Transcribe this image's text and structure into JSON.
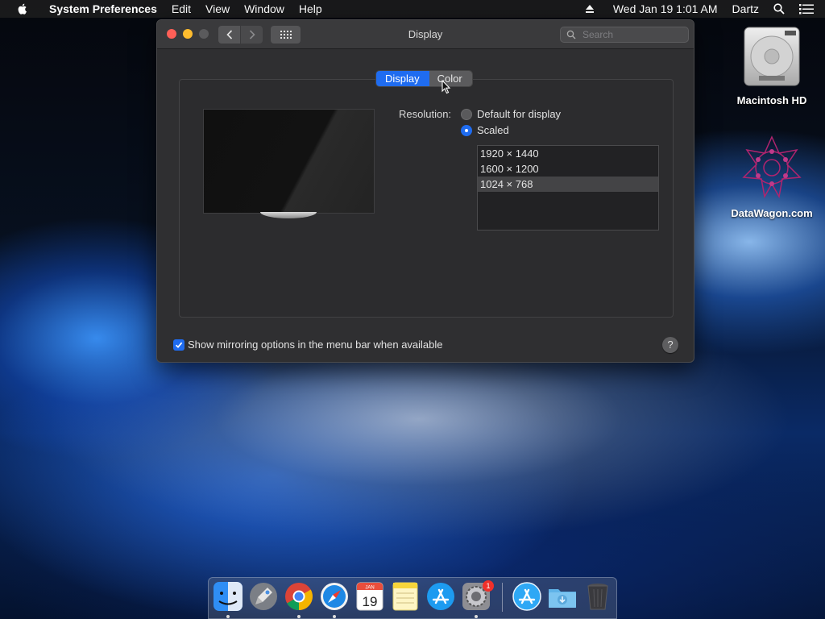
{
  "menubar": {
    "app_name": "System Preferences",
    "menus": [
      "Edit",
      "View",
      "Window",
      "Help"
    ],
    "datetime": "Wed Jan 19  1:01 AM",
    "user": "Dartz"
  },
  "window": {
    "title": "Display",
    "search_placeholder": "Search",
    "tabs": [
      {
        "label": "Display",
        "selected": true
      },
      {
        "label": "Color",
        "selected": false
      }
    ],
    "resolution_label": "Resolution:",
    "resolution_options": [
      {
        "label": "Default for display",
        "selected": false
      },
      {
        "label": "Scaled",
        "selected": true
      }
    ],
    "scaled_resolutions": [
      {
        "label": "1920 × 1440",
        "selected": false
      },
      {
        "label": "1600 × 1200",
        "selected": false
      },
      {
        "label": "1024 × 768",
        "selected": true
      }
    ],
    "mirroring_checkbox": {
      "label": "Show mirroring options in the menu bar when available",
      "checked": true
    },
    "help_label": "?"
  },
  "desktop_icons": [
    {
      "label": "Macintosh HD",
      "icon": "hard-drive-icon"
    },
    {
      "label": "DataWagon.com",
      "icon": "datawagon-logo-icon"
    }
  ],
  "dock": {
    "apps": [
      "finder-icon",
      "launchpad-icon",
      "chrome-icon",
      "safari-icon",
      "calendar-icon",
      "notes-icon",
      "app-store-icon",
      "system-preferences-icon"
    ],
    "calendar": {
      "month": "JAN",
      "day": "19"
    },
    "system_prefs_badge": "1",
    "right_items": [
      "app-store-downloads-icon",
      "downloads-folder-icon",
      "trash-icon"
    ]
  },
  "colors": {
    "accent": "#1f6cf0",
    "close": "#fe5f57",
    "minimize": "#febc2e"
  }
}
